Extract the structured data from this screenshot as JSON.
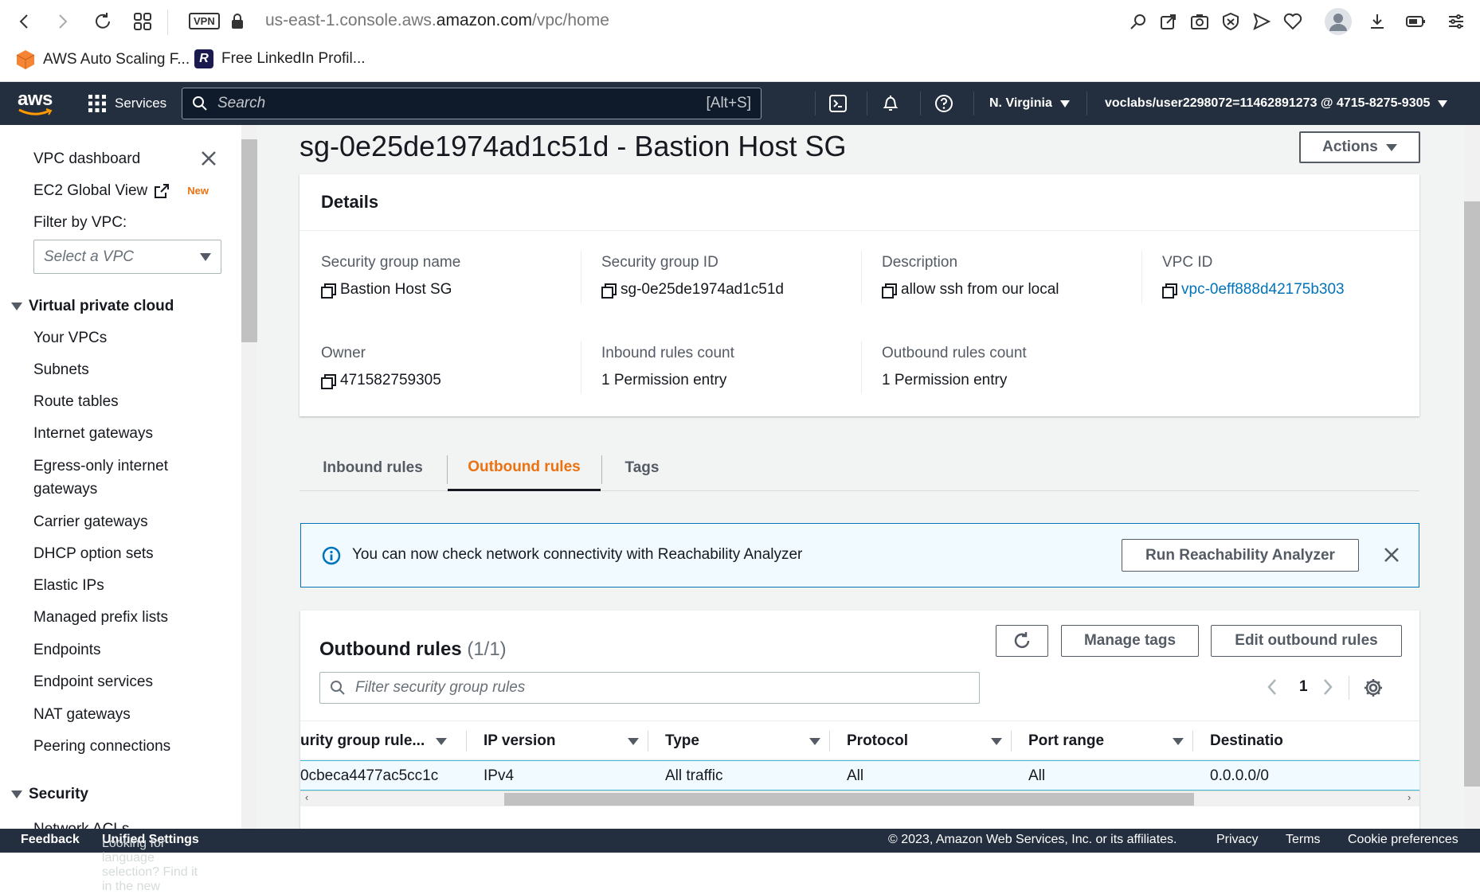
{
  "browser": {
    "url_prefix": "us-east-1.console.aws.",
    "url_domain": "amazon.com",
    "url_path": "/vpc/home",
    "vpn_badge": "VPN",
    "bookmarks": [
      {
        "label": "AWS Auto Scaling F...",
        "icon": "aws-hexagon-icon",
        "color": "#f58534"
      },
      {
        "label": "Free LinkedIn Profil...",
        "icon": "r-logo-icon",
        "color": "#1a1a4e",
        "letter": "R"
      }
    ]
  },
  "aws_nav": {
    "logo": "aws",
    "services_label": "Services",
    "search_placeholder": "Search",
    "search_hint": "[Alt+S]",
    "region": "N. Virginia",
    "account": "voclabs/user2298072=11462891273 @ 4715-8275-9305"
  },
  "sidebar": {
    "top_links": [
      "VPC dashboard",
      "EC2 Global View"
    ],
    "new_badge": "New",
    "filter_label": "Filter by VPC:",
    "filter_placeholder": "Select a VPC",
    "section_vpc": "Virtual private cloud",
    "vpc_items": [
      "Your VPCs",
      "Subnets",
      "Route tables",
      "Internet gateways",
      "Egress-only internet",
      "gateways",
      "Carrier gateways",
      "DHCP option sets",
      "Elastic IPs",
      "Managed prefix lists",
      "Endpoints",
      "Endpoint services",
      "NAT gateways",
      "Peering connections"
    ],
    "section_security": "Security",
    "security_items": [
      "Network ACLs"
    ]
  },
  "page": {
    "title": "sg-0e25de1974ad1c51d - Bastion Host SG",
    "actions_label": "Actions"
  },
  "details": {
    "heading": "Details",
    "fields": {
      "sg_name_label": "Security group name",
      "sg_name": "Bastion Host SG",
      "sg_id_label": "Security group ID",
      "sg_id": "sg-0e25de1974ad1c51d",
      "desc_label": "Description",
      "desc": "allow ssh from our local",
      "vpc_id_label": "VPC ID",
      "vpc_id": "vpc-0eff888d42175b303",
      "owner_label": "Owner",
      "owner": "471582759305",
      "inbound_count_label": "Inbound rules count",
      "inbound_count": "1 Permission entry",
      "outbound_count_label": "Outbound rules count",
      "outbound_count": "1 Permission entry"
    }
  },
  "tabs": [
    "Inbound rules",
    "Outbound rules",
    "Tags"
  ],
  "active_tab": "Outbound rules",
  "info_banner": {
    "text": "You can now check network connectivity with Reachability Analyzer",
    "button": "Run Reachability Analyzer"
  },
  "rules": {
    "heading": "Outbound rules",
    "count": "(1/1)",
    "manage_tags": "Manage tags",
    "edit_rules": "Edit outbound rules",
    "filter_placeholder": "Filter security group rules",
    "page": "1",
    "columns": [
      "urity group rule...",
      "IP version",
      "Type",
      "Protocol",
      "Port range",
      "Destinatio"
    ],
    "rows": [
      [
        "0cbeca4477ac5cc1c",
        "IPv4",
        "All traffic",
        "All",
        "All",
        "0.0.0.0/0"
      ]
    ]
  },
  "footer": {
    "feedback": "Feedback",
    "lang_text": "Looking for language selection? Find it in the new",
    "unified": "Unified Settings",
    "copyright": "© 2023, Amazon Web Services, Inc. or its affiliates.",
    "privacy": "Privacy",
    "terms": "Terms",
    "cookies": "Cookie preferences"
  },
  "colors": {
    "accent_orange": "#ec7211",
    "link_blue": "#0073bb",
    "nav_bg": "#232f3e",
    "info_blue": "#0073bb"
  }
}
